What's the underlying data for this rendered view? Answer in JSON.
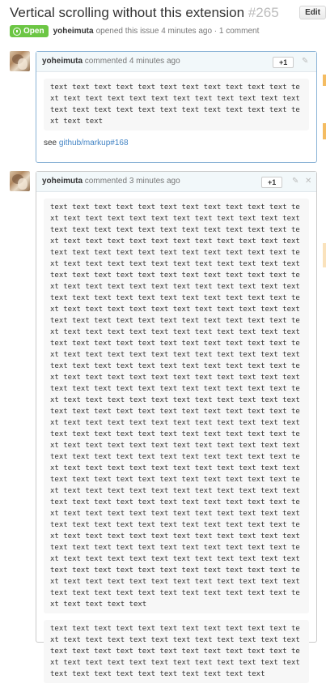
{
  "issue": {
    "title": "Vertical scrolling without this extension",
    "number": "#265",
    "edit_label": "Edit",
    "state": "Open",
    "author": "yoheimuta",
    "meta_text": "opened this issue 4 minutes ago · 1 comment"
  },
  "comments": [
    {
      "author": "yoheimuta",
      "time": "commented 4 minutes ago",
      "plus_one": "+1",
      "code": "text text text text text text text text text text text text text text text text text text text text text text text text text text text text text text text text text text text text text",
      "see_prefix": "see ",
      "link": "github/markup#168"
    },
    {
      "author": "yoheimuta",
      "time": "commented 3 minutes ago",
      "plus_one": "+1",
      "code1": "text text text text text text text text text text text text text text text text text text text text text text text text text text text text text text text text text text text text text text text text text text text text text text text text text text text text text text text text text text text text text text text text text text text text text text text text text text text text text text text text text text text text text text text text text text text text text text text text text text text text text text text text text text text text text text text text text text text text text text text text text text text text text text text text text text text text text text text text text text text text text text text text text text text text text text text text text text text text text text text text text text text text text text text text text text text text text text text text text text text text text text text text text text text text text text text text text text text text text text text text text text text text text text text text text text text text text text text text text text text text text text text text text text text text text text text text text text text text text text text text text text text text text text text text text text text text text text text text text text text text text text text text text text text text text text text text text text text text text text text text text text text text text text text text text text text text text text text text text text text text text text text text text text text text text text text text text text text text text text text text text text text text text text text text text text text text text text text text text text text text text text text text text text text text text text text text text text text text text text text text text text text text text text text text text text text text text text text text text text text text text text text text text text text text text text text text text text text text text text text text text text text text text text text",
      "code2": "text text text text text text text text text text text text text text text text text text text text text text text text text text text text text text text text text text text text text text text text text text text text text text text text text text text text text text text text"
    }
  ]
}
